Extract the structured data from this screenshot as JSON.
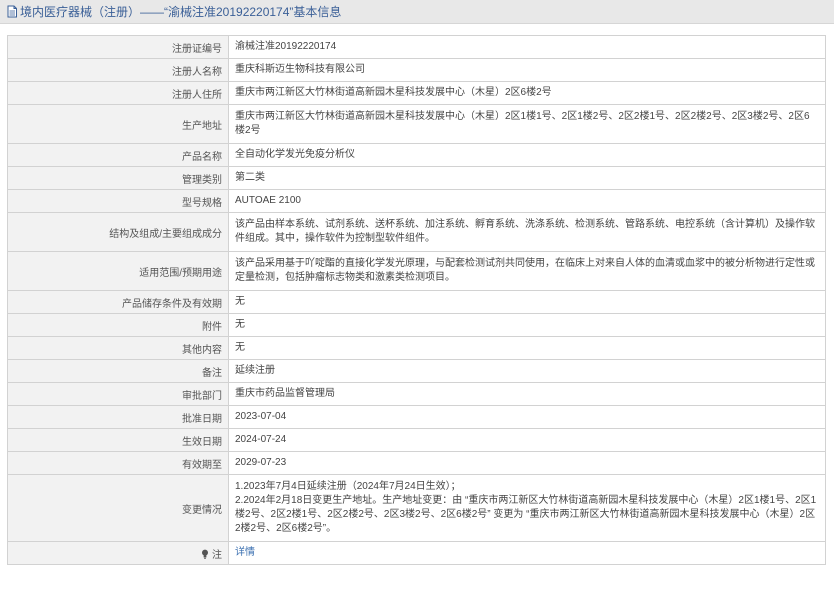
{
  "header": {
    "title": "境内医疗器械（注册）——“渝械注准20192220174”基本信息"
  },
  "rows": [
    {
      "label": "注册证编号",
      "value": "渝械注准20192220174"
    },
    {
      "label": "注册人名称",
      "value": "重庆科斯迈生物科技有限公司"
    },
    {
      "label": "注册人住所",
      "value": "重庆市两江新区大竹林街道高新园木星科技发展中心（木星）2区6楼2号"
    },
    {
      "label": "生产地址",
      "value": "重庆市两江新区大竹林街道高新园木星科技发展中心（木星）2区1楼1号、2区1楼2号、2区2楼1号、2区2楼2号、2区3楼2号、2区6楼2号"
    },
    {
      "label": "产品名称",
      "value": "全自动化学发光免疫分析仪"
    },
    {
      "label": "管理类别",
      "value": "第二类"
    },
    {
      "label": "型号规格",
      "value": "AUTOAE 2100"
    },
    {
      "label": "结构及组成/主要组成成分",
      "value": "该产品由样本系统、试剂系统、送杯系统、加注系统、孵育系统、洗涤系统、检测系统、管路系统、电控系统（含计算机）及操作软件组成。其中，操作软件为控制型软件组件。"
    },
    {
      "label": "适用范围/预期用途",
      "value": "该产品采用基于吖啶酯的直接化学发光原理，与配套检测试剂共同使用，在临床上对来自人体的血清或血浆中的被分析物进行定性或定量检测，包括肿瘤标志物类和激素类检测项目。"
    },
    {
      "label": "产品储存条件及有效期",
      "value": "无"
    },
    {
      "label": "附件",
      "value": "无"
    },
    {
      "label": "其他内容",
      "value": "无"
    },
    {
      "label": "备注",
      "value": "延续注册"
    },
    {
      "label": "审批部门",
      "value": "重庆市药品监督管理局"
    },
    {
      "label": "批准日期",
      "value": "2023-07-04"
    },
    {
      "label": "生效日期",
      "value": "2024-07-24"
    },
    {
      "label": "有效期至",
      "value": "2029-07-23"
    },
    {
      "label": "变更情况",
      "value_lines": [
        "1.2023年7月4日延续注册（2024年7月24日生效）；",
        "2.2024年2月18日变更生产地址。生产地址变更：由 “重庆市两江新区大竹林街道高新园木星科技发展中心（木星）2区1楼1号、2区1楼2号、2区2楼1号、2区2楼2号、2区3楼2号、2区6楼2号” 变更为 “重庆市两江新区大竹林街道高新园木星科技发展中心（木星）2区2楼2号、2区6楼2号”。"
      ]
    },
    {
      "label": "注",
      "value": "详情"
    }
  ]
}
